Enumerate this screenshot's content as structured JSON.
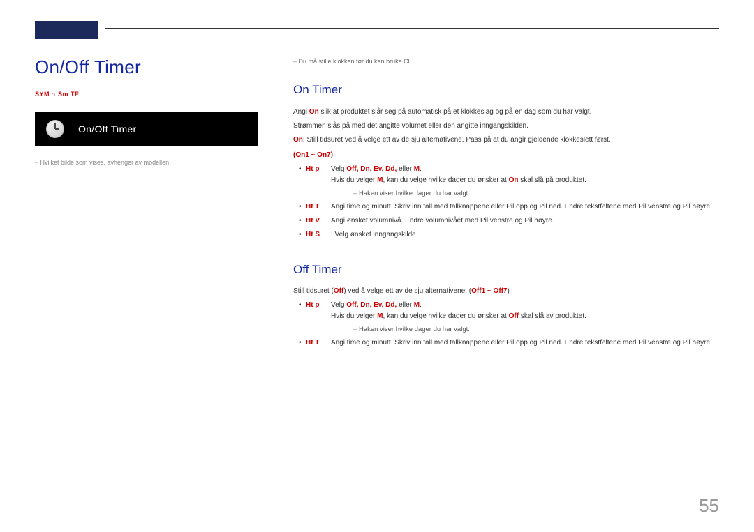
{
  "page_title": "On/Off Timer",
  "breadcrumb": "SYM  ⌂  Sm  TE",
  "screenshot_label": "On/Off Timer",
  "left_caption": "Hvilket bilde som vises, avhenger av modellen.",
  "top_note": "Du må stille klokken før du kan bruke Cl.",
  "on_section": {
    "heading": "On Timer",
    "p1_pre": "Angi ",
    "p1_red": "On",
    "p1_post": " slik at produktet slår seg på automatisk på et klokkeslag og på en dag som du har valgt.",
    "p2": "Strømmen slås på med det angitte volumet eller den angitte inngangskilden.",
    "p3_pre": "",
    "p3_red": "On",
    "p3_post": ": Still tidsuret ved å velge ett av de sju alternativene. Pass på at du angir gjeldende klokkeslett først.",
    "range": "(On1 ~ On7)",
    "items": [
      {
        "label": "Ht  p",
        "desc_pre": "Velg ",
        "desc_red": "Off, Dn, Ev, Dd, ",
        "desc_mid": "eller ",
        "desc_red2": "M",
        "desc_post": ".",
        "extra_pre": "Hvis du velger ",
        "extra_red": "M",
        "extra_mid": ", kan du velge hvilke dager du ønsker at ",
        "extra_red2": "On",
        "extra_post": " skal slå på produktet.",
        "sub": "Haken viser hvilke dager du har valgt."
      },
      {
        "label": "Ht  T",
        "desc_post": "Angi time og minutt. Skriv inn tall med tallknappene eller Pil opp og Pil ned. Endre tekstfeltene med Pil venstre og Pil høyre."
      },
      {
        "label": "Ht  V",
        "desc_post": "Angi ønsket volumnivå. Endre volumnivået med Pil venstre og Pil høyre."
      },
      {
        "label": "Ht  S",
        "desc_post": ": Velg ønsket inngangskilde."
      }
    ]
  },
  "off_section": {
    "heading": "Off Timer",
    "p1_pre": "Still tidsuret (",
    "p1_red": "Off",
    "p1_mid": ") ved å velge ett av de sju alternativene. (",
    "p1_red2": "Off1 ~ Off7",
    "p1_post": ")",
    "items": [
      {
        "label": "Ht  p",
        "desc_pre": "Velg ",
        "desc_red": "Off, Dn, Ev, Dd, ",
        "desc_mid": "eller ",
        "desc_red2": "M",
        "desc_post": ".",
        "extra_pre": "Hvis du velger ",
        "extra_red": "M",
        "extra_mid": ", kan du velge hvilke dager du ønsker at ",
        "extra_red2": "Off",
        "extra_post": " skal slå av produktet.",
        "sub": "Haken viser hvilke dager du har valgt."
      },
      {
        "label": "Ht  T",
        "desc_post": "Angi time og minutt. Skriv inn tall med tallknappene eller Pil opp og Pil ned. Endre tekstfeltene med Pil venstre og Pil høyre."
      }
    ]
  },
  "page_number": "55"
}
